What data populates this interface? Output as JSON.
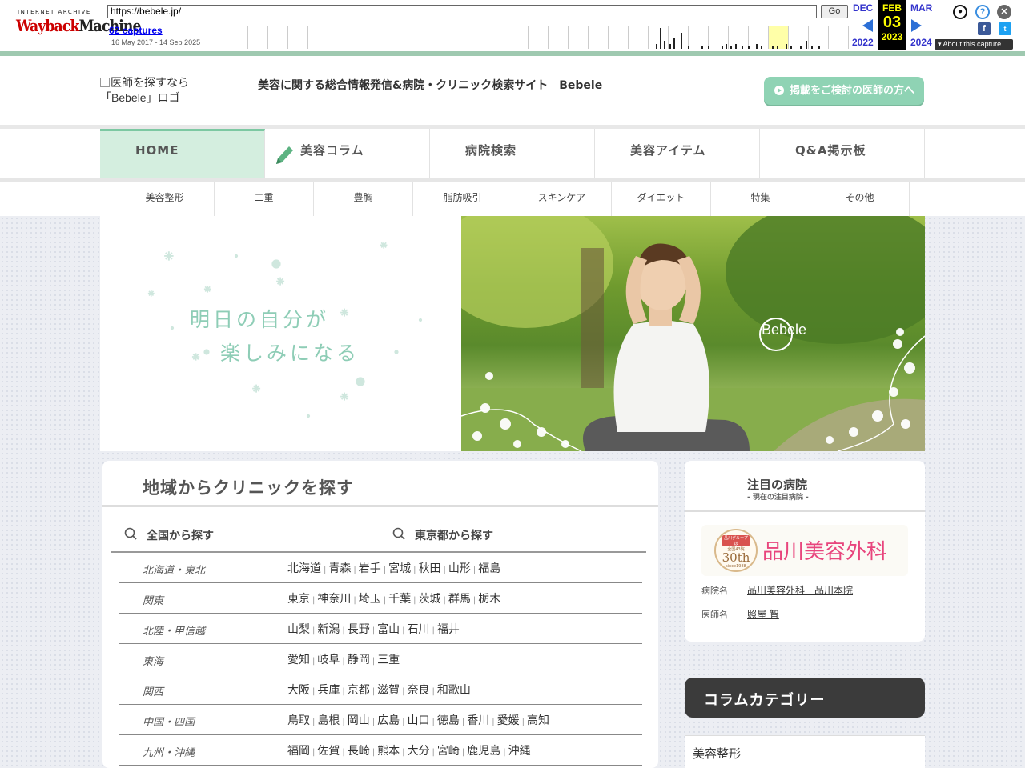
{
  "wayback": {
    "logo_top": "INTERNET ARCHIVE",
    "logo_main_a": "Wayback",
    "logo_main_b": "Machine",
    "url": "https://bebele.jp/",
    "go_label": "Go",
    "captures": "62 captures",
    "range": "16 May 2017 - 14 Sep 2025",
    "prev_month": "DEC",
    "prev_year": "2022",
    "cur_month": "FEB",
    "cur_day": "03",
    "cur_year": "2023",
    "next_month": "MAR",
    "next_year": "2024",
    "about": "About this capture",
    "icons": [
      "user-icon",
      "help-icon",
      "close-icon",
      "facebook-icon",
      "twitter-icon"
    ]
  },
  "header": {
    "logo_alt": "医師を探すなら「Bebele」ロゴ",
    "tagline": "美容に関する総合情報発信&病院・クリニック検索サイト　Bebele",
    "cta": "掲載をご検討の医師の方へ"
  },
  "nav": [
    "HOME",
    "美容コラム",
    "病院検索",
    "美容アイテム",
    "Q&A掲示板"
  ],
  "subnav": [
    "美容整形",
    "二重",
    "豊胸",
    "脂肪吸引",
    "スキンケア",
    "ダイエット",
    "特集",
    "その他"
  ],
  "hero": {
    "line1": "明日の自分が",
    "line2": "楽しみになる",
    "brand": "Bebele"
  },
  "area": {
    "title": "地域からクリニックを探す",
    "tab_all": "全国から探す",
    "tab_tokyo": "東京都から探す",
    "rows": [
      {
        "region": "北海道・東北",
        "prefs": [
          "北海道",
          "青森",
          "岩手",
          "宮城",
          "秋田",
          "山形",
          "福島"
        ]
      },
      {
        "region": "関東",
        "prefs": [
          "東京",
          "神奈川",
          "埼玉",
          "千葉",
          "茨城",
          "群馬",
          "栃木"
        ]
      },
      {
        "region": "北陸・甲信越",
        "prefs": [
          "山梨",
          "新潟",
          "長野",
          "富山",
          "石川",
          "福井"
        ]
      },
      {
        "region": "東海",
        "prefs": [
          "愛知",
          "岐阜",
          "静岡",
          "三重"
        ]
      },
      {
        "region": "関西",
        "prefs": [
          "大阪",
          "兵庫",
          "京都",
          "滋賀",
          "奈良",
          "和歌山"
        ]
      },
      {
        "region": "中国・四国",
        "prefs": [
          "鳥取",
          "島根",
          "岡山",
          "広島",
          "山口",
          "徳島",
          "香川",
          "愛媛",
          "高知"
        ]
      },
      {
        "region": "九州・沖縄",
        "prefs": [
          "福岡",
          "佐賀",
          "長崎",
          "熊本",
          "大分",
          "宮崎",
          "鹿児島",
          "沖縄"
        ]
      }
    ]
  },
  "featured": {
    "title": "注目の病院",
    "subtitle": "- 現在の注目病院 -",
    "seal_top": "品川グループは",
    "seal_mid": "全国43院",
    "seal_num": "30th",
    "seal_since": "since1988",
    "brand": "品川美容外科",
    "hospital_label": "病院名",
    "hospital_value": "品川美容外科　品川本院",
    "doctor_label": "医師名",
    "doctor_value": "照屋 智"
  },
  "column": {
    "title": "コラムカテゴリー",
    "first": "美容整形"
  }
}
